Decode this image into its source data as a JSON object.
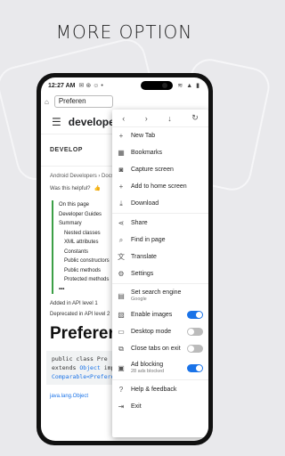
{
  "promo": {
    "title": "MORE OPTION"
  },
  "status": {
    "time": "12:27 AM"
  },
  "tab": {
    "label": "Preferen"
  },
  "toolbar": {
    "back": "‹",
    "forward": "›",
    "download": "↓",
    "refresh": "↻"
  },
  "page": {
    "brand": "developers",
    "section": "DEVELOP",
    "breadcrumb": "Android Developers  ›  Docs  ›  Guid",
    "helpful": "Was this helpful?",
    "toc": [
      "On this page",
      "Developer Guides",
      "Summary",
      "Nested classes",
      "XML attributes",
      "Constants",
      "Public constructors",
      "Public methods",
      "Protected methods",
      "•••"
    ],
    "added": "Added in API level 1",
    "deprecated": "Deprecated in API level 2",
    "title": "Preferer",
    "code_line1": "public class Pre",
    "code_line2a": "extends ",
    "code_line2b": "Object",
    "code_line2c": " implements",
    "code_line3": "Comparable<Preference>",
    "footer_link": "java.lang.Object"
  },
  "menu": {
    "items": [
      {
        "label": "New Tab",
        "icon": "plus-icon"
      },
      {
        "label": "Bookmarks",
        "icon": "bookmark-icon"
      },
      {
        "label": "Capture screen",
        "icon": "camera-icon"
      },
      {
        "label": "Add to home screen",
        "icon": "plus-icon"
      },
      {
        "label": "Download",
        "icon": "download-icon"
      },
      {
        "label": "Share",
        "icon": "share-icon"
      },
      {
        "label": "Find in page",
        "icon": "search-icon"
      },
      {
        "label": "Translate",
        "icon": "translate-icon"
      },
      {
        "label": "Settings",
        "icon": "gear-icon"
      },
      {
        "label": "Set search engine",
        "sub": "Google",
        "icon": "search-engine-icon"
      },
      {
        "label": "Enable images",
        "icon": "image-icon",
        "toggle": true
      },
      {
        "label": "Desktop mode",
        "icon": "desktop-icon",
        "toggle": false
      },
      {
        "label": "Close tabs on exit",
        "icon": "close-tabs-icon",
        "toggle": false
      },
      {
        "label": "Ad blocking",
        "sub": "28 ads blocked",
        "icon": "ad-block-icon",
        "toggle": true
      },
      {
        "label": "Help & feedback",
        "icon": "help-icon"
      },
      {
        "label": "Exit",
        "icon": "exit-icon"
      }
    ]
  },
  "colors": {
    "accent": "#1a73e8",
    "toc_bar": "#3c9f46"
  }
}
